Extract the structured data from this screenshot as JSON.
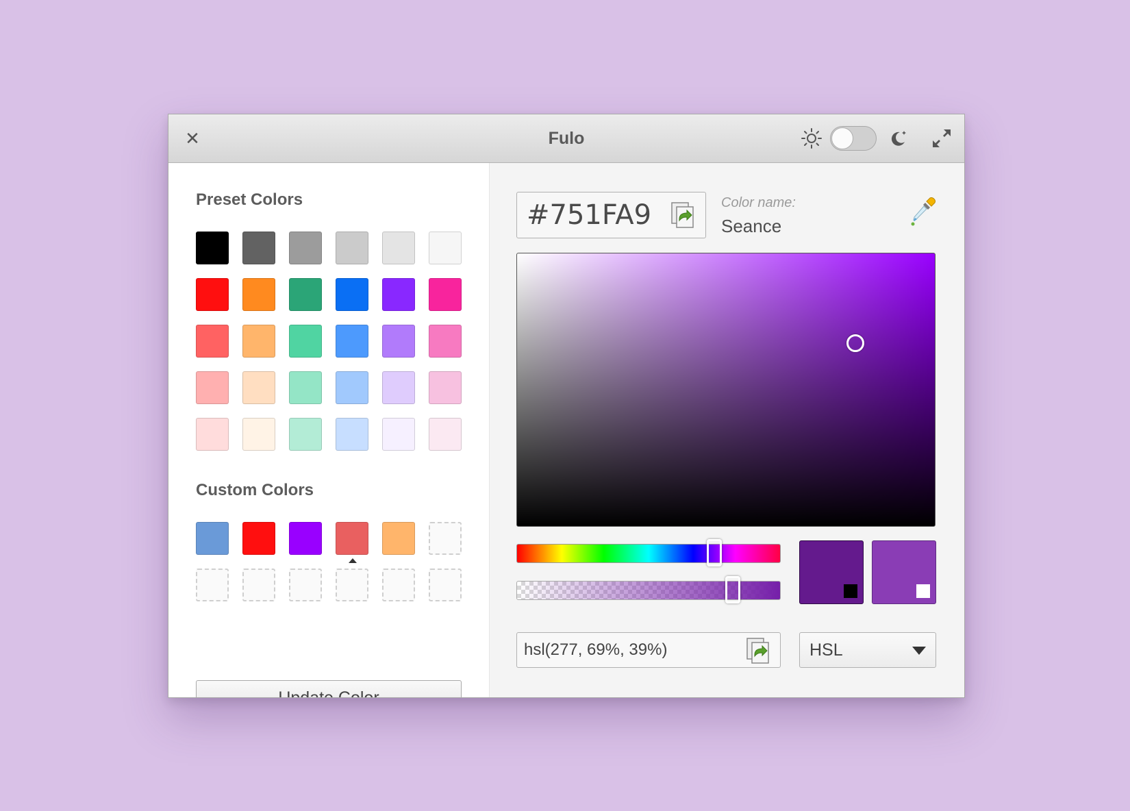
{
  "window": {
    "title": "Fulo",
    "close_glyph": "✕",
    "theme_toggle": {
      "light_icon": "sun-icon",
      "dark_icon": "moon-icon",
      "dark_mode": false
    },
    "maximize_icon": "maximize-icon"
  },
  "left_panel": {
    "preset_title": "Preset Colors",
    "preset_colors": [
      "#000000",
      "#626262",
      "#9c9c9c",
      "#cbcbcb",
      "#e4e4e4",
      "#f6f6f6",
      "#ff0f0f",
      "#ff8a1f",
      "#2ba577",
      "#0a6ff4",
      "#8928ff",
      "#f8249d",
      "#ff6262",
      "#ffb56b",
      "#50d4a2",
      "#4d9afd",
      "#b17bfb",
      "#f77ac1",
      "#ffb0b0",
      "#ffdec1",
      "#94e5c6",
      "#a1c9fd",
      "#dfccfd",
      "#f7c1e0",
      "#ffdcdc",
      "#fff3e6",
      "#b3ecd6",
      "#c7deff",
      "#f6f0ff",
      "#fbe9f2"
    ],
    "custom_title": "Custom Colors",
    "custom_colors": [
      "#6a9ad8",
      "#ff0f0f",
      "#9900ff",
      "#e96060",
      "#ffb56b",
      null,
      null,
      null,
      null,
      null,
      null,
      null
    ],
    "custom_selected_index": 3,
    "update_button_label": "Update Color"
  },
  "right_panel": {
    "hex_value": "#751FA9",
    "color_name_label": "Color name:",
    "color_name": "Seance",
    "eyedropper_icon": "eyedropper-icon",
    "copy_icon": "copy-icon",
    "picker": {
      "hue": 277,
      "saturation_fraction": 0.81,
      "value_fraction": 0.67,
      "hue_fraction": 0.75,
      "alpha_fraction": 0.82
    },
    "preview": {
      "current_color": "#641a8d",
      "previous_color": "#8a3db5",
      "current_marker_color": "#000000",
      "previous_marker_color": "#ffffff"
    },
    "format_value": "hsl(277, 69%, 39%)",
    "format_select": {
      "selected": "HSL"
    }
  }
}
